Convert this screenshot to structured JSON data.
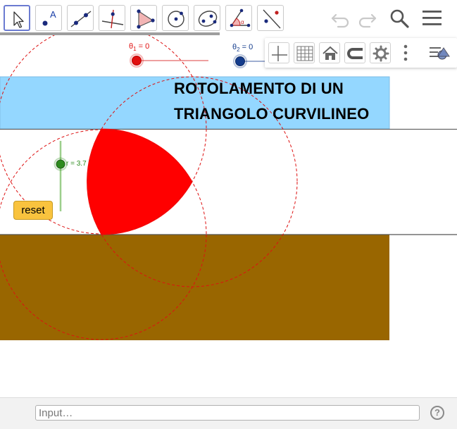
{
  "app": {
    "name": "GeoGebra"
  },
  "toolbar": {
    "tools": [
      {
        "name": "move",
        "icon": "move-arrow-icon"
      },
      {
        "name": "point",
        "icon": "point-icon"
      },
      {
        "name": "line",
        "icon": "line-icon"
      },
      {
        "name": "perpendicular",
        "icon": "perpendicular-line-icon"
      },
      {
        "name": "polygon",
        "icon": "polygon-icon"
      },
      {
        "name": "circle",
        "icon": "circle-center-point-icon"
      },
      {
        "name": "ellipse",
        "icon": "ellipse-icon"
      },
      {
        "name": "angle",
        "icon": "angle-icon"
      },
      {
        "name": "reflect",
        "icon": "reflect-line-icon"
      }
    ],
    "active_tool": "move",
    "right": [
      "undo-icon",
      "redo-icon",
      "search-icon",
      "menu-icon"
    ]
  },
  "style_bar": {
    "buttons": [
      "axes-icon",
      "grid-icon",
      "home-icon",
      "point-capture-icon",
      "settings-icon",
      "more-icon",
      "toggle-style-bar-icon"
    ]
  },
  "graphics": {
    "title_line1": "ROTOLAMENTO DI UN",
    "title_line2": "TRIANGOLO CURVILINEO",
    "theta1": {
      "symbol": "θ",
      "sub": "1",
      "rest": " = 0",
      "value": 0,
      "color": "#e01010"
    },
    "theta2": {
      "symbol": "θ",
      "sub": "2",
      "rest": " = 0",
      "value": 0,
      "color": "#143c8c"
    },
    "r_slider": {
      "label": "r = 3.7",
      "color": "#2e8b1f"
    },
    "reset_label": "reset",
    "colors": {
      "band": "#94d7ff",
      "ground": "#996600",
      "triangle": "#ff0000",
      "circles": "#dd1111"
    }
  },
  "input_bar": {
    "placeholder": "Input…"
  }
}
